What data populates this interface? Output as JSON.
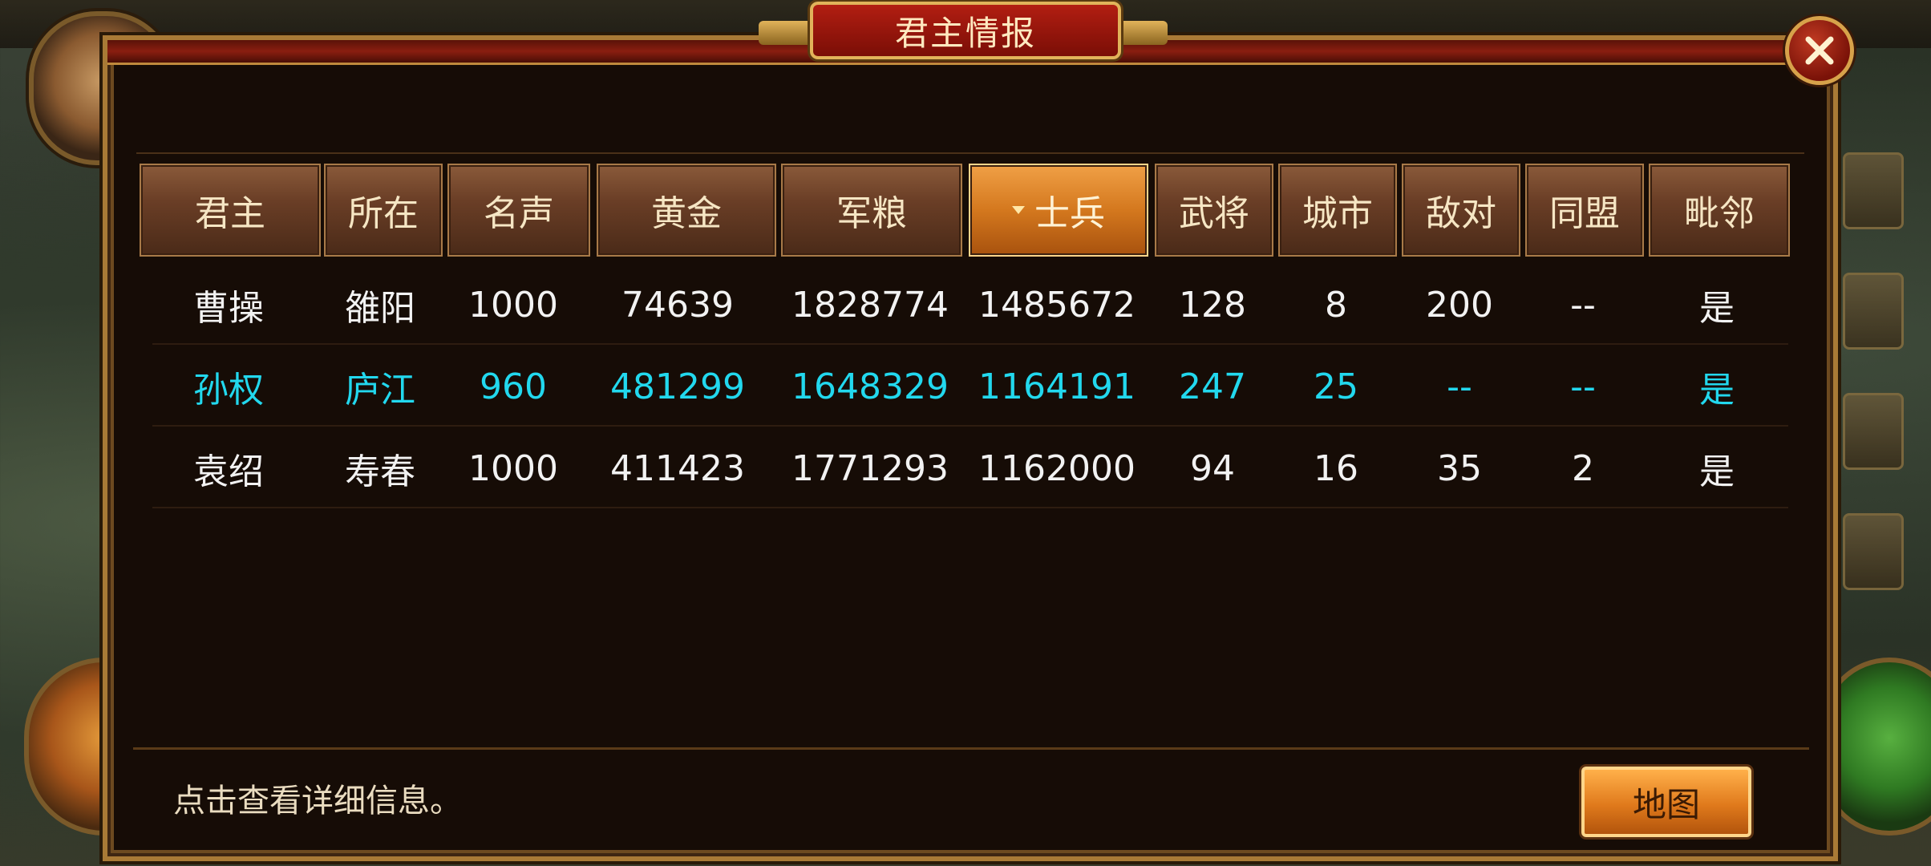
{
  "window": {
    "title": "君主情报"
  },
  "table": {
    "headers": [
      "君主",
      "所在",
      "名声",
      "黄金",
      "军粮",
      "士兵",
      "武将",
      "城市",
      "敌对",
      "同盟",
      "毗邻"
    ],
    "rows": [
      [
        "曹操",
        "雒阳",
        "1000",
        "74639",
        "1828774",
        "1485672",
        "128",
        "8",
        "200",
        "--",
        "是"
      ],
      [
        "孙权",
        "庐江",
        "960",
        "481299",
        "1648329",
        "1164191",
        "247",
        "25",
        "--",
        "--",
        "是"
      ],
      [
        "袁绍",
        "寿春",
        "1000",
        "411423",
        "1771293",
        "1162000",
        "94",
        "16",
        "35",
        "2",
        "是"
      ]
    ],
    "sorted_by": "士兵",
    "highlight_color": "#22d8ee"
  },
  "footer": {
    "hint": "点击查看详细信息。",
    "map_button": "地图"
  },
  "icons": {
    "close": "close-icon",
    "sort": "sort-desc-icon"
  }
}
